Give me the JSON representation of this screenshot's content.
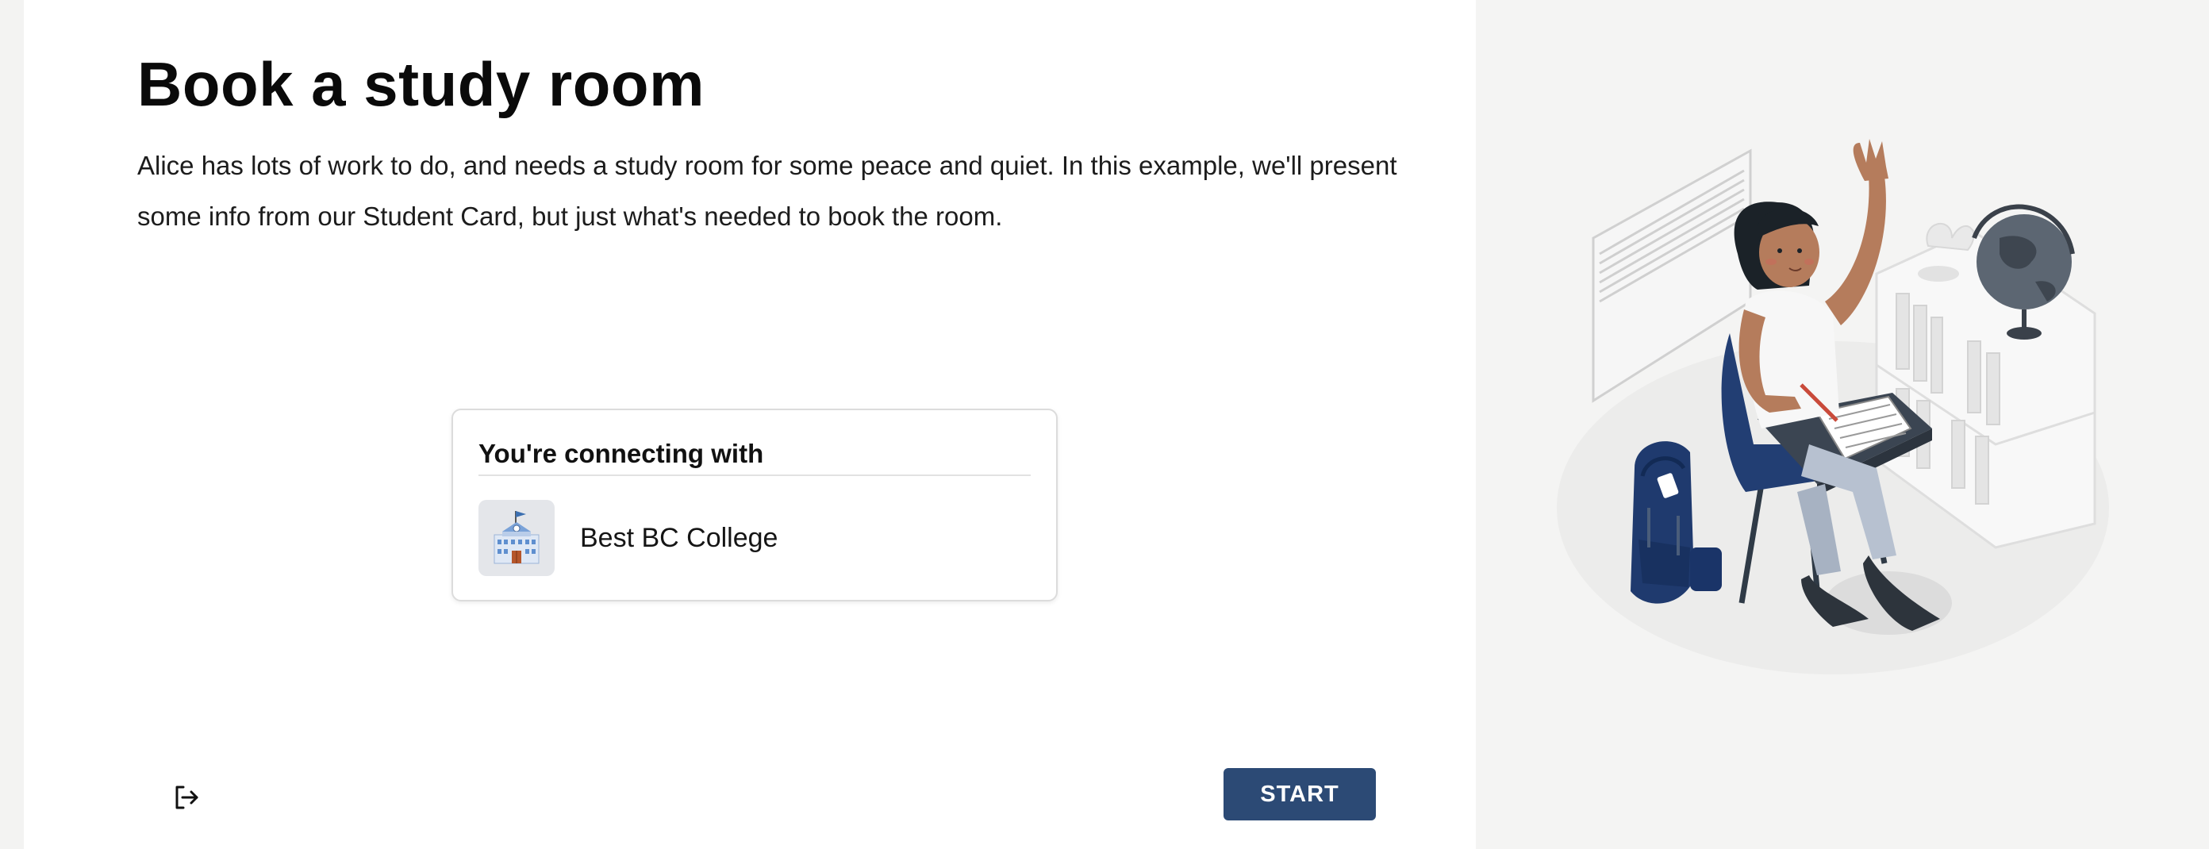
{
  "page": {
    "title": "Book a study room",
    "description": "Alice has lots of work to do, and needs a study room for some peace and quiet. In this example, we'll present some info from our Student Card, but just what's needed to book the room."
  },
  "connection_card": {
    "heading": "You're connecting with",
    "organization": {
      "name": "Best BC College",
      "logo_icon": "school-building-icon"
    }
  },
  "footer": {
    "exit_icon": "logout-icon",
    "start_label": "START"
  },
  "illustration": {
    "subject": "student-raising-hand-illustration"
  },
  "colors": {
    "primary_button": "#2c4a75",
    "panel_background": "#f4f4f3",
    "main_background": "#ffffff"
  }
}
